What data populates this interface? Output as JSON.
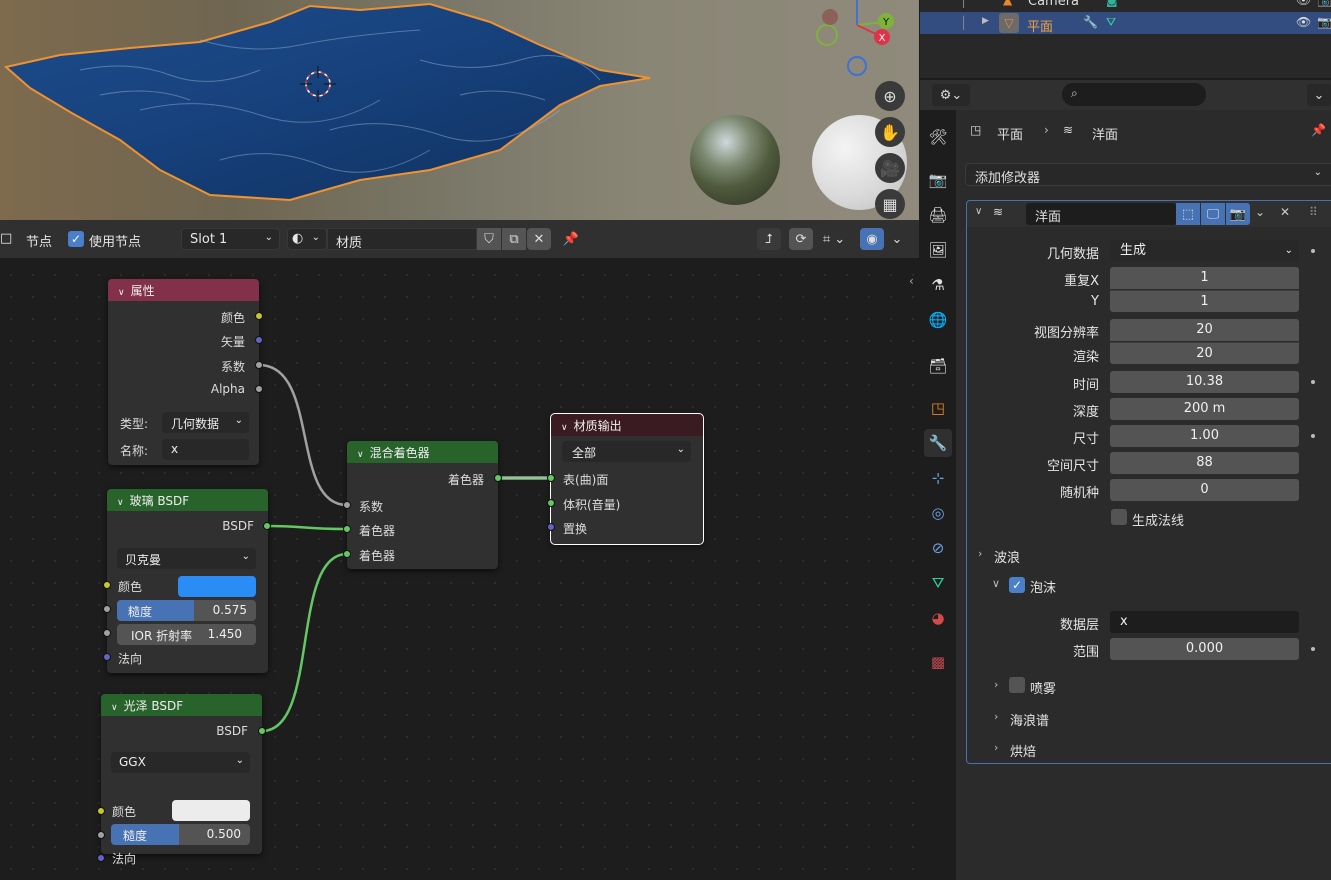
{
  "viewport": {
    "gizmo_axes": {
      "y": "Y",
      "x": "X"
    },
    "nav_icons": [
      "zoom-icon",
      "hand-icon",
      "camera-icon",
      "grid-icon"
    ]
  },
  "node_header": {
    "menu_label": "节点",
    "use_nodes_label": "使用节点",
    "slot_value": "Slot 1",
    "material_name": "材质"
  },
  "nodes": {
    "attribute": {
      "title": "属性",
      "outputs": [
        "颜色",
        "矢量",
        "系数",
        "Alpha"
      ],
      "type_label": "类型:",
      "type_value": "几何数据",
      "name_label": "名称:",
      "name_value": "x"
    },
    "glass": {
      "title": "玻璃 BSDF",
      "output": "BSDF",
      "distribution": "贝克曼",
      "color_label": "颜色",
      "color_value": "#2a8cf5",
      "roughness_label": "糙度",
      "roughness_value": "0.575",
      "roughness_fraction": 0.575,
      "ior_label": "IOR 折射率",
      "ior_value": "1.450",
      "normal_label": "法向"
    },
    "glossy": {
      "title": "光泽 BSDF",
      "output": "BSDF",
      "distribution": "GGX",
      "color_label": "颜色",
      "color_value": "#ececec",
      "roughness_label": "糙度",
      "roughness_value": "0.500",
      "roughness_fraction": 0.5,
      "normal_label": "法向"
    },
    "mix": {
      "title": "混合着色器",
      "output": "着色器",
      "inputs": [
        "系数",
        "着色器",
        "着色器"
      ]
    },
    "output": {
      "title": "材质输出",
      "target": "全部",
      "inputs": [
        "表(曲)面",
        "体积(音量)",
        "置换"
      ]
    }
  },
  "outliner": {
    "rows": [
      {
        "label": "Camera"
      },
      {
        "label": "平面"
      }
    ]
  },
  "properties": {
    "breadcrumb": [
      "平面",
      "洋面"
    ],
    "add_modifier": "添加修改器",
    "modifier_name": "洋面",
    "fields": [
      {
        "label": "几何数据",
        "value": "生成"
      },
      {
        "label": "重复X",
        "value": "1"
      },
      {
        "label": "Y",
        "value": "1"
      },
      {
        "label": "视图分辨率",
        "value": "20"
      },
      {
        "label": "渲染",
        "value": "20"
      },
      {
        "label": "时间",
        "value": "10.38"
      },
      {
        "label": "深度",
        "value": "200 m"
      },
      {
        "label": "尺寸",
        "value": "1.00"
      },
      {
        "label": "空间尺寸",
        "value": "88"
      },
      {
        "label": "随机种",
        "value": "0"
      }
    ],
    "gen_normals_label": "生成法线",
    "waves_label": "波浪",
    "foam_label": "泡沫",
    "foam_layer_label": "数据层",
    "foam_layer_value": "x",
    "coverage_label": "范围",
    "coverage_value": "0.000",
    "spray_label": "喷雾",
    "spectrum_label": "海浪谱",
    "bake_label": "烘焙"
  },
  "colors": {
    "accent": "#4772b3",
    "selected_outline": "#e8872c",
    "attr_header": "#83314a",
    "shader_header": "#27632a",
    "output_header": "#3b1b22"
  }
}
